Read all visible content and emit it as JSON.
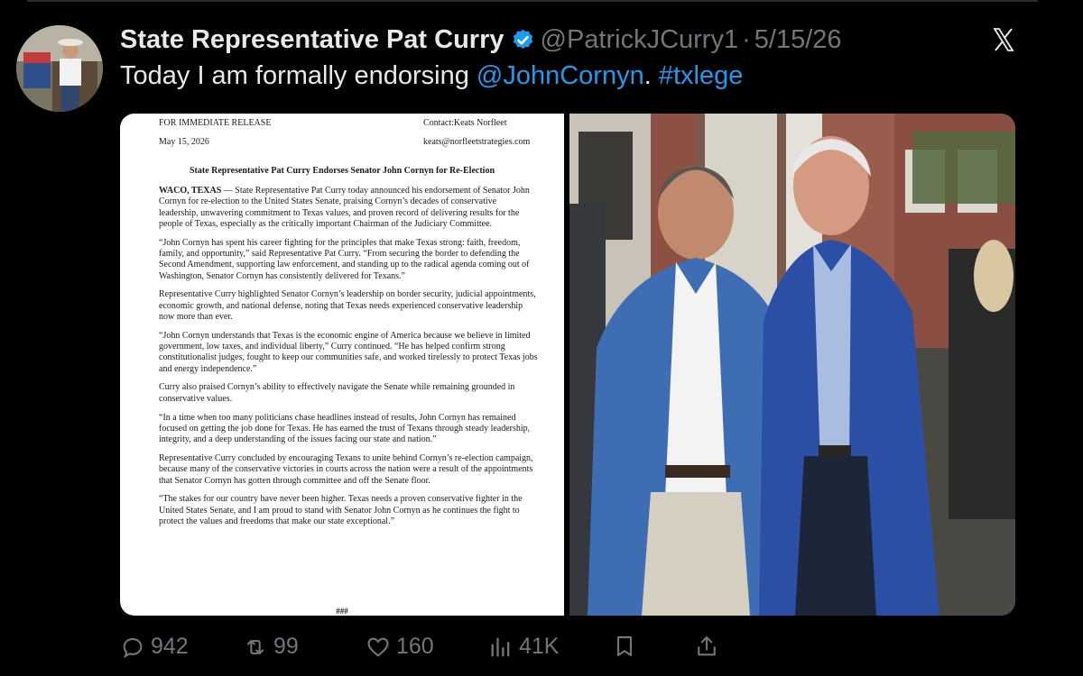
{
  "author": {
    "name": "State Representative Pat Curry",
    "handle": "@PatrickJCurry1",
    "separator": "·",
    "date": "5/15/26"
  },
  "tweet": {
    "text_before": "Today I am formally endorsing ",
    "mention": "@JohnCornyn",
    "text_middle": ". ",
    "hashtag": "#txlege"
  },
  "press_release": {
    "release_line": "FOR IMMEDIATE RELEASE",
    "contact": "Contact:Keats Norfleet",
    "date": "May 15, 2026",
    "email": "keats@norfleetstrategies.com",
    "headline": "State Representative Pat Curry Endorses Senator John Cornyn for Re-Election",
    "dateline": "WACO, TEXAS",
    "p1": " — State Representative Pat Curry today announced his endorsement of Senator John Cornyn for re-election to the United States Senate, praising Cornyn’s decades of conservative leadership, unwavering commitment to Texas values, and proven record of delivering results for the people of Texas, especially as the critically important Chairman of the Judiciary Committee.",
    "p2": "“John Cornyn has spent his career fighting for the principles that make Texas strong: faith, freedom, family, and opportunity,” said Representative Pat Curry. “From securing the border to defending the Second Amendment, supporting law enforcement, and standing up to the radical agenda coming out of Washington, Senator Cornyn has consistently delivered for Texans.”",
    "p3": "Representative Curry highlighted Senator Cornyn’s leadership on border security, judicial appointments, economic growth, and national defense, noting that Texas needs experienced conservative leadership now more than ever.",
    "p4": "“John Cornyn understands that Texas is the economic engine of America because we believe in limited government, low taxes, and individual liberty,” Curry continued. “He has helped confirm strong constitutionalist judges, fought to keep our communities safe, and worked tirelessly to protect Texas jobs and energy independence.”",
    "p5": "Curry also praised Cornyn’s ability to effectively navigate the Senate while remaining grounded in conservative values.",
    "p6": "“In a time when too many politicians chase headlines instead of results, John Cornyn has remained focused on getting the job done for Texas. He has earned the trust of Texans through steady leadership, integrity, and a deep understanding of the issues facing our state and nation.”",
    "p7": "Representative Curry concluded by encouraging Texans to unite behind Cornyn’s re-election campaign, because many of the conservative victories in courts across the nation were a result of the appointments that Senator Cornyn has gotten through committee and off the Senate floor.",
    "p8": "“The stakes for our country have never been higher. Texas needs a proven conservative fighter in the United States Senate, and I am proud to stand with Senator John Cornyn as he continues the fight to protect the values and freedoms that make our state exceptional.”",
    "end_mark": "###"
  },
  "actions": {
    "replies": "942",
    "reposts": "99",
    "likes": "160",
    "views": "41K"
  },
  "colors": {
    "background": "#000000",
    "text": "#e7e9ea",
    "muted": "#71767b",
    "link": "#1d9bf0"
  },
  "icons": [
    "verified-badge-icon",
    "close-icon",
    "reply-icon",
    "repost-icon",
    "like-icon",
    "views-icon",
    "bookmark-icon",
    "share-icon"
  ]
}
